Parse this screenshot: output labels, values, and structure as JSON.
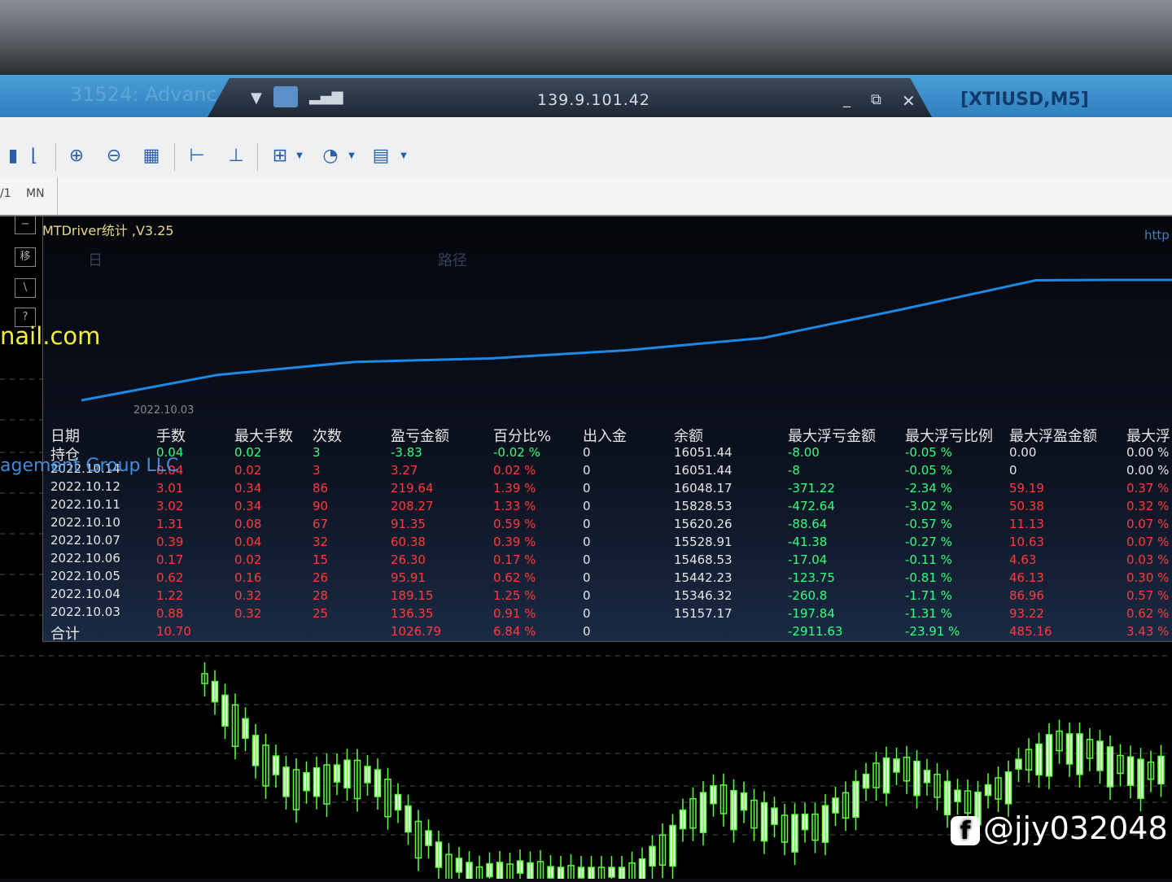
{
  "window": {
    "title": "31524: Advanc",
    "host": "139.9.101.42",
    "symbol": "[XTIUSD,M5]",
    "minimize": "_",
    "restore": "⧉",
    "close": "✕"
  },
  "toolbar": {
    "timeframes": [
      "/1",
      "MN"
    ]
  },
  "panel": {
    "title": "MTDriver统计 ,V3.25",
    "menu": "日",
    "menu_path": "路径",
    "side_buttons": [
      "−",
      "移",
      "\\",
      "?"
    ],
    "http": "http",
    "email": "nail.com",
    "mgmt": "agement Group LLC",
    "start_date": "2022.10.03"
  },
  "colors": {
    "equity_line": "#1e88e5",
    "positive": "#ff3b3b",
    "negative": "#35ff7a",
    "neutral": "#e6e6e6",
    "candle": "#5cff3a"
  },
  "equity_curve": {
    "balances": [
      15157.17,
      15346.32,
      15442.23,
      15468.53,
      15528.91,
      15620.26,
      15828.53,
      16048.17,
      16051.44
    ]
  },
  "table": {
    "headers": [
      "日期",
      "手数",
      "最大手数",
      "次数",
      "盈亏金额",
      "百分比%",
      "出入金",
      "余额",
      "最大浮亏金额",
      "最大浮亏比例",
      "最大浮盈金额",
      "最大浮"
    ],
    "rows": [
      {
        "label": "持仓",
        "cells": [
          "0.04",
          "0.02",
          "3",
          "-3.83",
          "-0.02 %",
          "0",
          "16051.44",
          "-8.00",
          "-0.05 %",
          "0.00",
          "0.00 %"
        ],
        "tone": "neg"
      },
      {
        "label": "2022.10.14",
        "cells": [
          "0.04",
          "0.02",
          "3",
          "3.27",
          "0.02 %",
          "0",
          "16051.44",
          "-8",
          "-0.05 %",
          "0",
          "0.00 %"
        ],
        "tone": "pos"
      },
      {
        "label": "2022.10.12",
        "cells": [
          "3.01",
          "0.34",
          "86",
          "219.64",
          "1.39 %",
          "0",
          "16048.17",
          "-371.22",
          "-2.34 %",
          "59.19",
          "0.37 %"
        ],
        "tone": "pos"
      },
      {
        "label": "2022.10.11",
        "cells": [
          "3.02",
          "0.34",
          "90",
          "208.27",
          "1.33 %",
          "0",
          "15828.53",
          "-472.64",
          "-3.02 %",
          "50.38",
          "0.32 %"
        ],
        "tone": "pos"
      },
      {
        "label": "2022.10.10",
        "cells": [
          "1.31",
          "0.08",
          "67",
          "91.35",
          "0.59 %",
          "0",
          "15620.26",
          "-88.64",
          "-0.57 %",
          "11.13",
          "0.07 %"
        ],
        "tone": "pos"
      },
      {
        "label": "2022.10.07",
        "cells": [
          "0.39",
          "0.04",
          "32",
          "60.38",
          "0.39 %",
          "0",
          "15528.91",
          "-41.38",
          "-0.27 %",
          "10.63",
          "0.07 %"
        ],
        "tone": "pos"
      },
      {
        "label": "2022.10.06",
        "cells": [
          "0.17",
          "0.02",
          "15",
          "26.30",
          "0.17 %",
          "0",
          "15468.53",
          "-17.04",
          "-0.11 %",
          "4.63",
          "0.03 %"
        ],
        "tone": "pos"
      },
      {
        "label": "2022.10.05",
        "cells": [
          "0.62",
          "0.16",
          "26",
          "95.91",
          "0.62 %",
          "0",
          "15442.23",
          "-123.75",
          "-0.81 %",
          "46.13",
          "0.30 %"
        ],
        "tone": "pos"
      },
      {
        "label": "2022.10.04",
        "cells": [
          "1.22",
          "0.32",
          "28",
          "189.15",
          "1.25 %",
          "0",
          "15346.32",
          "-260.8",
          "-1.71 %",
          "86.96",
          "0.57 %"
        ],
        "tone": "pos"
      },
      {
        "label": "2022.10.03",
        "cells": [
          "0.88",
          "0.32",
          "25",
          "136.35",
          "0.91 %",
          "0",
          "15157.17",
          "-197.84",
          "-1.31 %",
          "93.22",
          "0.62 %"
        ],
        "tone": "pos"
      },
      {
        "label": "合计",
        "cells": [
          "10.70",
          "",
          "",
          "1026.79",
          "6.84 %",
          "0",
          "",
          "-2911.63",
          "-23.91 %",
          "485.16",
          "3.43 %"
        ],
        "tone": "pos"
      }
    ]
  },
  "watermark": "@jjy032048",
  "watermark_icon": "f"
}
